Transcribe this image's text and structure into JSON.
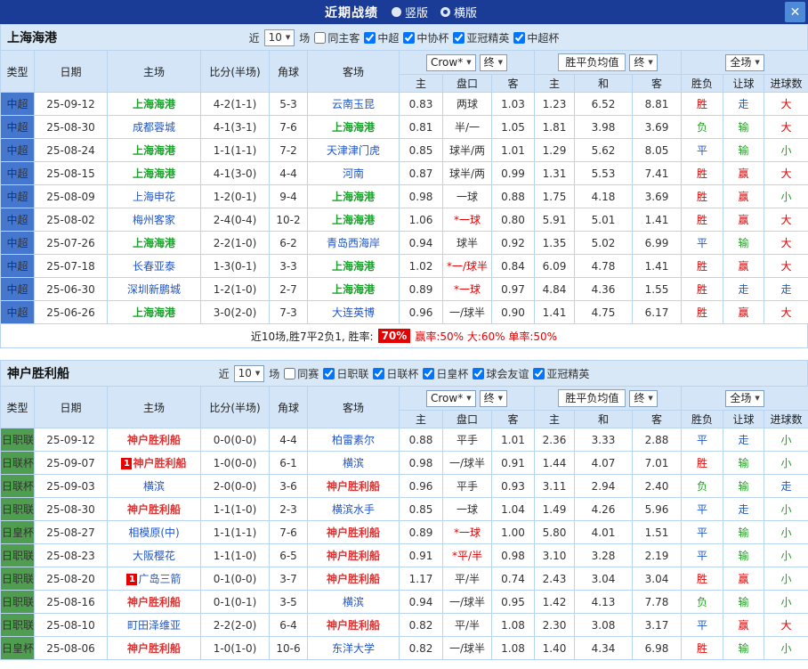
{
  "topbar": {
    "title": "近期战绩",
    "options": [
      {
        "label": "竖版",
        "selected": false
      },
      {
        "label": "横版",
        "selected": true
      }
    ],
    "close": "✕"
  },
  "controls": {
    "near": "近",
    "count": "10",
    "games": "场",
    "source": "Crow*",
    "final": "终",
    "avg": "胜平负均值",
    "scope": "全场"
  },
  "columns": {
    "left": [
      "类型",
      "日期",
      "主场",
      "比分(半场)",
      "角球",
      "客场"
    ],
    "sub": [
      "主",
      "盘口",
      "客",
      "主",
      "和",
      "客",
      "胜负",
      "让球",
      "进球数"
    ]
  },
  "palette": {
    "result_win": "#e60000",
    "result_lose": "#21a021",
    "result_draw": "#2158c4",
    "link_blue": "#2056c7",
    "score_red": "#e60000"
  },
  "sections": [
    {
      "team": "上海海港",
      "team_color": "#18a229",
      "type_bg": "#4577cf",
      "filters": [
        {
          "label": "同主客",
          "checked": false
        },
        {
          "label": "中超",
          "checked": true
        },
        {
          "label": "中协杯",
          "checked": true
        },
        {
          "label": "亚冠精英",
          "checked": true
        },
        {
          "label": "中超杯",
          "checked": true
        }
      ],
      "rows": [
        {
          "type": "中超",
          "date": "25-09-12",
          "home": "上海海港",
          "home_badge": "",
          "score": "4-2(1-1)",
          "corners": "5-3",
          "away": "云南玉昆",
          "away_badge": "",
          "odds": [
            "0.83",
            "两球",
            "1.03"
          ],
          "avg": [
            "1.23",
            "6.52",
            "8.81"
          ],
          "results": [
            "胜",
            "走",
            "大"
          ]
        },
        {
          "type": "中超",
          "date": "25-08-30",
          "home": "成都蓉城",
          "home_badge": "",
          "score": "4-1(3-1)",
          "corners": "7-6",
          "away": "上海海港",
          "away_badge": "",
          "odds": [
            "0.81",
            "半/一",
            "1.05"
          ],
          "avg": [
            "1.81",
            "3.98",
            "3.69"
          ],
          "results": [
            "负",
            "输",
            "大"
          ]
        },
        {
          "type": "中超",
          "date": "25-08-24",
          "home": "上海海港",
          "home_badge": "",
          "score": "1-1(1-1)",
          "corners": "7-2",
          "away": "天津津门虎",
          "away_badge": "",
          "odds": [
            "0.85",
            "球半/两",
            "1.01"
          ],
          "avg": [
            "1.29",
            "5.62",
            "8.05"
          ],
          "results": [
            "平",
            "输",
            "小"
          ]
        },
        {
          "type": "中超",
          "date": "25-08-15",
          "home": "上海海港",
          "home_badge": "",
          "score": "4-1(3-0)",
          "corners": "4-4",
          "away": "河南",
          "away_badge": "",
          "odds": [
            "0.87",
            "球半/两",
            "0.99"
          ],
          "avg": [
            "1.31",
            "5.53",
            "7.41"
          ],
          "results": [
            "胜",
            "赢",
            "大"
          ]
        },
        {
          "type": "中超",
          "date": "25-08-09",
          "home": "上海申花",
          "home_badge": "",
          "score": "1-2(0-1)",
          "corners": "9-4",
          "away": "上海海港",
          "away_badge": "",
          "odds": [
            "0.98",
            "一球",
            "0.88"
          ],
          "avg": [
            "1.75",
            "4.18",
            "3.69"
          ],
          "results": [
            "胜",
            "赢",
            "小"
          ]
        },
        {
          "type": "中超",
          "date": "25-08-02",
          "home": "梅州客家",
          "home_badge": "",
          "score": "2-4(0-4)",
          "corners": "10-2",
          "away": "上海海港",
          "away_badge": "",
          "odds": [
            "1.06",
            "*一球",
            "0.80"
          ],
          "avg": [
            "5.91",
            "5.01",
            "1.41"
          ],
          "results": [
            "胜",
            "赢",
            "大"
          ]
        },
        {
          "type": "中超",
          "date": "25-07-26",
          "home": "上海海港",
          "home_badge": "",
          "score": "2-2(1-0)",
          "corners": "6-2",
          "away": "青岛西海岸",
          "away_badge": "",
          "odds": [
            "0.94",
            "球半",
            "0.92"
          ],
          "avg": [
            "1.35",
            "5.02",
            "6.99"
          ],
          "results": [
            "平",
            "输",
            "大"
          ]
        },
        {
          "type": "中超",
          "date": "25-07-18",
          "home": "长春亚泰",
          "home_badge": "",
          "score": "1-3(0-1)",
          "corners": "3-3",
          "away": "上海海港",
          "away_badge": "",
          "odds": [
            "1.02",
            "*一/球半",
            "0.84"
          ],
          "avg": [
            "6.09",
            "4.78",
            "1.41"
          ],
          "results": [
            "胜",
            "赢",
            "大"
          ]
        },
        {
          "type": "中超",
          "date": "25-06-30",
          "home": "深圳新鹏城",
          "home_badge": "",
          "score": "1-2(1-0)",
          "corners": "2-7",
          "away": "上海海港",
          "away_badge": "",
          "odds": [
            "0.89",
            "*一球",
            "0.97"
          ],
          "avg": [
            "4.84",
            "4.36",
            "1.55"
          ],
          "results": [
            "胜",
            "走",
            "走"
          ]
        },
        {
          "type": "中超",
          "date": "25-06-26",
          "home": "上海海港",
          "home_badge": "",
          "score": "3-0(2-0)",
          "corners": "7-3",
          "away": "大连英博",
          "away_badge": "",
          "odds": [
            "0.96",
            "一/球半",
            "0.90"
          ],
          "avg": [
            "1.41",
            "4.75",
            "6.17"
          ],
          "results": [
            "胜",
            "赢",
            "大"
          ]
        }
      ],
      "summary": {
        "prefix": "近10场,胜7平2负1, 胜率:",
        "rate": "70%",
        "tail": "赢率:50% 大:60% 单率:50%"
      }
    },
    {
      "team": "神户胜利船",
      "team_color": "#dd3333",
      "type_bg": "#4f9e4f",
      "filters": [
        {
          "label": "同赛",
          "checked": false
        },
        {
          "label": "日职联",
          "checked": true
        },
        {
          "label": "日联杯",
          "checked": true
        },
        {
          "label": "日皇杯",
          "checked": true
        },
        {
          "label": "球会友谊",
          "checked": true
        },
        {
          "label": "亚冠精英",
          "checked": true
        }
      ],
      "rows": [
        {
          "type": "日职联",
          "date": "25-09-12",
          "home": "神户胜利船",
          "home_badge": "",
          "score": "0-0(0-0)",
          "corners": "4-4",
          "away": "柏雷素尔",
          "away_badge": "",
          "odds": [
            "0.88",
            "平手",
            "1.01"
          ],
          "avg": [
            "2.36",
            "3.33",
            "2.88"
          ],
          "results": [
            "平",
            "走",
            "小"
          ]
        },
        {
          "type": "日联杯",
          "date": "25-09-07",
          "home": "神户胜利船",
          "home_badge": "1",
          "score": "1-0(0-0)",
          "corners": "6-1",
          "away": "横滨",
          "away_badge": "",
          "odds": [
            "0.98",
            "一/球半",
            "0.91"
          ],
          "avg": [
            "1.44",
            "4.07",
            "7.01"
          ],
          "results": [
            "胜",
            "输",
            "小"
          ]
        },
        {
          "type": "日联杯",
          "date": "25-09-03",
          "home": "横滨",
          "home_badge": "",
          "score": "2-0(0-0)",
          "corners": "3-6",
          "away": "神户胜利船",
          "away_badge": "",
          "odds": [
            "0.96",
            "平手",
            "0.93"
          ],
          "avg": [
            "3.11",
            "2.94",
            "2.40"
          ],
          "results": [
            "负",
            "输",
            "走"
          ]
        },
        {
          "type": "日职联",
          "date": "25-08-30",
          "home": "神户胜利船",
          "home_badge": "",
          "score": "1-1(1-0)",
          "corners": "2-3",
          "away": "横滨水手",
          "away_badge": "",
          "odds": [
            "0.85",
            "一球",
            "1.04"
          ],
          "avg": [
            "1.49",
            "4.26",
            "5.96"
          ],
          "results": [
            "平",
            "走",
            "小"
          ]
        },
        {
          "type": "日皇杯",
          "date": "25-08-27",
          "home": "相模原(中)",
          "home_badge": "",
          "score": "1-1(1-1)",
          "corners": "7-6",
          "away": "神户胜利船",
          "away_badge": "",
          "odds": [
            "0.89",
            "*一球",
            "1.00"
          ],
          "avg": [
            "5.80",
            "4.01",
            "1.51"
          ],
          "results": [
            "平",
            "输",
            "小"
          ]
        },
        {
          "type": "日职联",
          "date": "25-08-23",
          "home": "大阪樱花",
          "home_badge": "",
          "score": "1-1(1-0)",
          "corners": "6-5",
          "away": "神户胜利船",
          "away_badge": "",
          "odds": [
            "0.91",
            "*平/半",
            "0.98"
          ],
          "avg": [
            "3.10",
            "3.28",
            "2.19"
          ],
          "results": [
            "平",
            "输",
            "小"
          ]
        },
        {
          "type": "日职联",
          "date": "25-08-20",
          "home": "广岛三箭",
          "home_badge": "1",
          "score": "0-1(0-0)",
          "corners": "3-7",
          "away": "神户胜利船",
          "away_badge": "",
          "odds": [
            "1.17",
            "平/半",
            "0.74"
          ],
          "avg": [
            "2.43",
            "3.04",
            "3.04"
          ],
          "results": [
            "胜",
            "赢",
            "小"
          ]
        },
        {
          "type": "日职联",
          "date": "25-08-16",
          "home": "神户胜利船",
          "home_badge": "",
          "score": "0-1(0-1)",
          "corners": "3-5",
          "away": "横滨",
          "away_badge": "",
          "odds": [
            "0.94",
            "一/球半",
            "0.95"
          ],
          "avg": [
            "1.42",
            "4.13",
            "7.78"
          ],
          "results": [
            "负",
            "输",
            "小"
          ]
        },
        {
          "type": "日职联",
          "date": "25-08-10",
          "home": "町田泽维亚",
          "home_badge": "",
          "score": "2-2(2-0)",
          "corners": "6-4",
          "away": "神户胜利船",
          "away_badge": "",
          "odds": [
            "0.82",
            "平/半",
            "1.08"
          ],
          "avg": [
            "2.30",
            "3.08",
            "3.17"
          ],
          "results": [
            "平",
            "赢",
            "大"
          ]
        },
        {
          "type": "日皇杯",
          "date": "25-08-06",
          "home": "神户胜利船",
          "home_badge": "",
          "score": "1-0(1-0)",
          "corners": "10-6",
          "away": "东洋大学",
          "away_badge": "",
          "odds": [
            "0.82",
            "一/球半",
            "1.08"
          ],
          "avg": [
            "1.40",
            "4.34",
            "6.98"
          ],
          "results": [
            "胜",
            "输",
            "小"
          ]
        }
      ],
      "summary": null
    }
  ]
}
